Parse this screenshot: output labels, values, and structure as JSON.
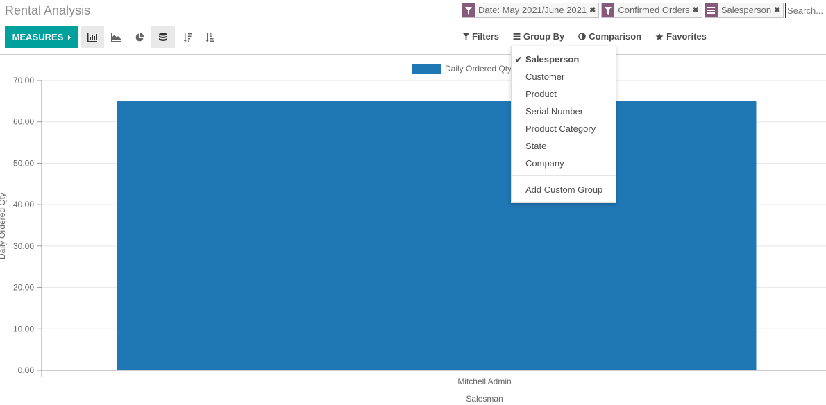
{
  "page": {
    "title": "Rental Analysis"
  },
  "toolbar": {
    "measures_label": "MEASURES",
    "view_buttons": [
      {
        "name": "bar-chart",
        "active": true
      },
      {
        "name": "line-chart",
        "active": false
      },
      {
        "name": "pie-chart",
        "active": false
      },
      {
        "name": "stacked",
        "active": true
      },
      {
        "name": "sort-descending",
        "active": false
      },
      {
        "name": "sort-ascending",
        "active": false
      }
    ]
  },
  "search": {
    "facets": [
      {
        "type": "filter",
        "label": "Date: May 2021/June 2021"
      },
      {
        "type": "filter",
        "label": "Confirmed Orders"
      },
      {
        "type": "groupby",
        "label": "Salesperson"
      }
    ],
    "placeholder": "Search...",
    "facet_color": "#875a7b"
  },
  "search_options": {
    "filters": "Filters",
    "group_by": "Group By",
    "comparison": "Comparison",
    "favorites": "Favorites"
  },
  "group_by_menu": {
    "items": [
      {
        "label": "Salesperson",
        "selected": true
      },
      {
        "label": "Customer",
        "selected": false
      },
      {
        "label": "Product",
        "selected": false
      },
      {
        "label": "Serial Number",
        "selected": false
      },
      {
        "label": "Product Category",
        "selected": false
      },
      {
        "label": "State",
        "selected": false
      },
      {
        "label": "Company",
        "selected": false
      }
    ],
    "custom": "Add Custom Group"
  },
  "colors": {
    "accent": "#00a09d",
    "bar": "#1f77b4"
  },
  "chart_data": {
    "type": "bar",
    "categories": [
      "Mitchell Admin"
    ],
    "series": [
      {
        "name": "Daily Ordered Qty",
        "values": [
          65
        ]
      }
    ],
    "xlabel": "Salesman",
    "ylabel": "Daily Ordered Qty",
    "ylim": [
      0,
      70
    ],
    "yticks": [
      "0.00",
      "10.00",
      "20.00",
      "30.00",
      "40.00",
      "50.00",
      "60.00",
      "70.00"
    ],
    "ytick_values": [
      0,
      10,
      20,
      30,
      40,
      50,
      60,
      70
    ],
    "legend": "top-center",
    "grid": true
  }
}
